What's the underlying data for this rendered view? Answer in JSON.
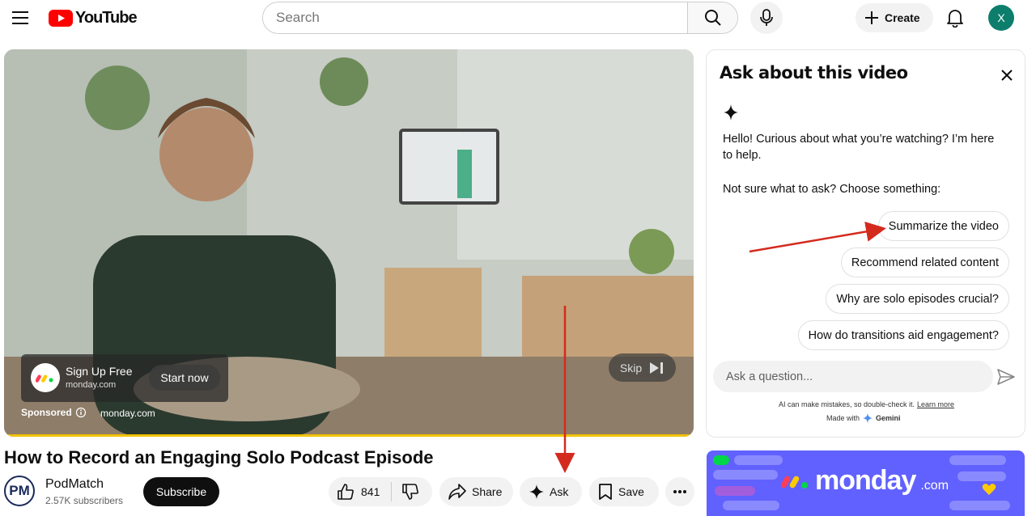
{
  "topbar": {
    "logo_text": "YouTube",
    "search_placeholder": "Search",
    "create_label": "Create",
    "avatar_letter": "X"
  },
  "player": {
    "ad": {
      "title": "Sign Up Free",
      "domain": "monday.com",
      "cta": "Start now",
      "sponsored_label": "Sponsored",
      "sponsor_domain": "monday.com",
      "skip_label": "Skip"
    }
  },
  "video": {
    "title": "How to Record an Engaging Solo Podcast Episode",
    "channel": {
      "avatar_text": "PM",
      "name": "PodMatch",
      "subscribers": "2.57K subscribers"
    },
    "actions": {
      "subscribe": "Subscribe",
      "likes": "841",
      "share": "Share",
      "ask": "Ask",
      "save": "Save"
    }
  },
  "ask_panel": {
    "title": "Ask about this video",
    "greeting": "Hello! Curious about what you’re watching? I’m here to help.",
    "hint": "Not sure what to ask? Choose something:",
    "suggestions": [
      "Summarize the video",
      "Recommend related content",
      "Why are solo episodes crucial?",
      "How do transitions aid engagement?"
    ],
    "input_placeholder": "Ask a question...",
    "disclaimer": "AI can make mistakes, so double-check it.",
    "learn_more": "Learn more",
    "made_with": "Made with",
    "made_with_brand": "Gemini"
  },
  "side_ad": {
    "brand": "monday",
    "tld": ".com"
  },
  "colors": {
    "youtube_red": "#ff0000",
    "avatar_bg": "#0d7d6c",
    "annotation_arrow": "#d42a1e",
    "progress": "#f2c200",
    "banner_bg": "#6161ff"
  }
}
